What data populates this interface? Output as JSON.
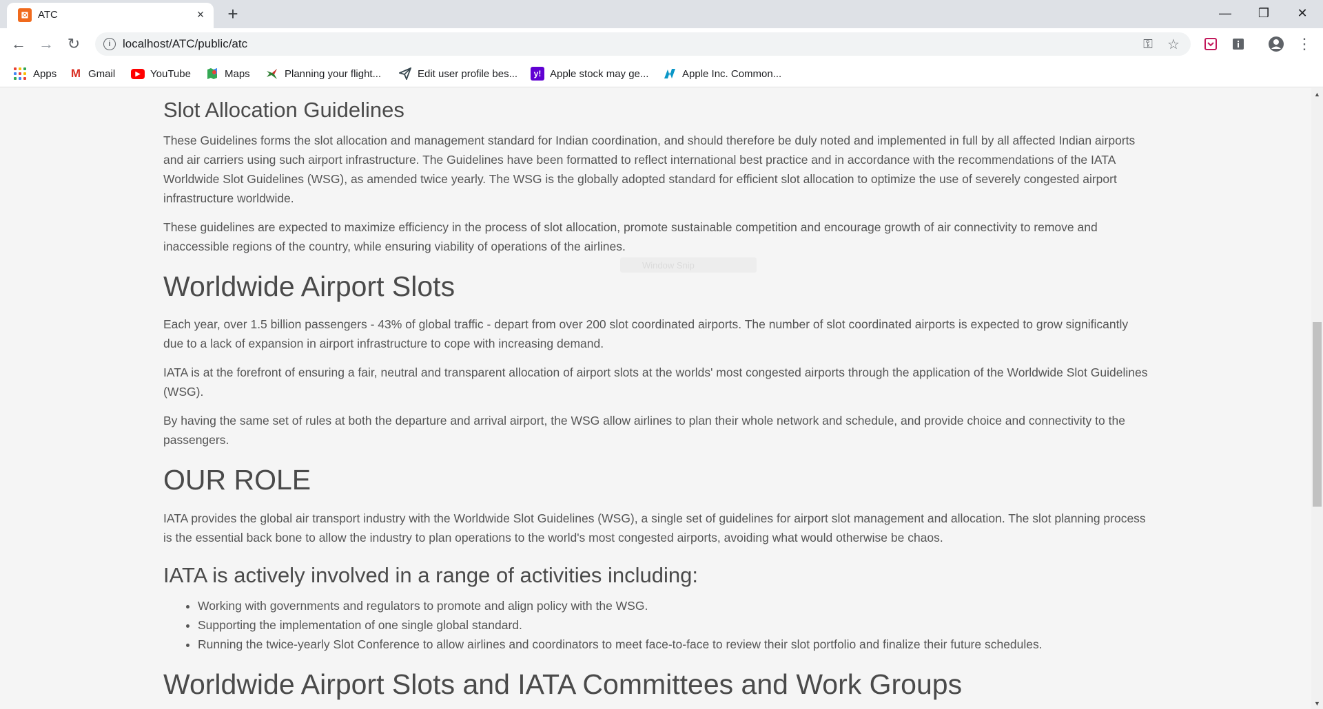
{
  "browser": {
    "tab_title": "ATC",
    "url": "localhost/ATC/public/atc",
    "icons": {
      "favicon": "xampp-icon",
      "close": "×",
      "new_tab": "+",
      "back": "←",
      "forward": "→",
      "reload": "↻",
      "info": "i",
      "key": "⚿",
      "star": "☆",
      "menu": "⋮",
      "minimize": "—",
      "restore": "❐",
      "close_window": "✕"
    },
    "bookmarks": [
      {
        "label": "Apps",
        "icon": "apps-grid-icon"
      },
      {
        "label": "Gmail",
        "icon": "gmail-icon"
      },
      {
        "label": "YouTube",
        "icon": "youtube-icon"
      },
      {
        "label": "Maps",
        "icon": "maps-icon"
      },
      {
        "label": "Planning your flight...",
        "icon": "plane-icon"
      },
      {
        "label": "Edit user profile bes...",
        "icon": "send-icon"
      },
      {
        "label": "Apple stock may ge...",
        "icon": "yahoo-icon"
      },
      {
        "label": "Apple Inc. Common...",
        "icon": "nasdaq-icon"
      }
    ],
    "colors": {
      "favicon": "#f06a1d",
      "gmail": "#d93025",
      "youtube": "#ff0000",
      "yahoo": "#6001d2",
      "nasdaq": "#0996c7"
    }
  },
  "page": {
    "ghost_text": "Window Snip",
    "sections": {
      "slot_guidelines": {
        "heading": "Slot Allocation Guidelines",
        "p1": "These Guidelines forms the slot allocation and management standard for Indian coordination, and should therefore be duly noted and implemented in full by all affected Indian airports and air carriers using such airport infrastructure. The Guidelines have been formatted to reflect international best practice and in accordance with the recommendations of the IATA Worldwide Slot Guidelines (WSG), as amended twice yearly. The WSG is the globally adopted standard for efficient slot allocation to optimize the use of severely congested airport infrastructure worldwide.",
        "p2": "These guidelines are expected to maximize efficiency in the process of slot allocation, promote sustainable competition and encourage growth of air connectivity to remove and inaccessible regions of the country, while ensuring viability of operations of the airlines."
      },
      "worldwide_slots": {
        "heading": "Worldwide Airport Slots",
        "p1": "Each year, over 1.5 billion passengers - 43% of global traffic - depart from over 200 slot coordinated airports. The number of slot coordinated airports is expected to grow significantly due to a lack of expansion in airport infrastructure to cope with increasing demand.",
        "p2": "IATA is at the forefront of ensuring a fair, neutral and transparent allocation of airport slots at the worlds' most congested airports through the application of the Worldwide Slot Guidelines (WSG).",
        "p3": "By having the same set of rules at both the departure and arrival airport, the WSG allow airlines to plan their whole network and schedule, and provide choice and connectivity to the passengers."
      },
      "our_role": {
        "heading": "OUR ROLE",
        "p1": "IATA provides the global air transport industry with the Worldwide Slot Guidelines (WSG), a single set of guidelines for airport slot management and allocation. The slot planning process is the essential back bone to allow the industry to plan operations to the world's most congested airports, avoiding what would otherwise be chaos."
      },
      "activities": {
        "heading": "IATA is actively involved in a range of activities including:",
        "items": [
          "Working with governments and regulators to promote and align policy with the WSG.",
          "Supporting the implementation of one single global standard.",
          "Running the twice-yearly Slot Conference to allow airlines and coordinators to meet face-to-face to review their slot portfolio and finalize their future schedules."
        ]
      },
      "committees": {
        "heading": "Worldwide Airport Slots and IATA Committees and Work Groups"
      }
    }
  }
}
